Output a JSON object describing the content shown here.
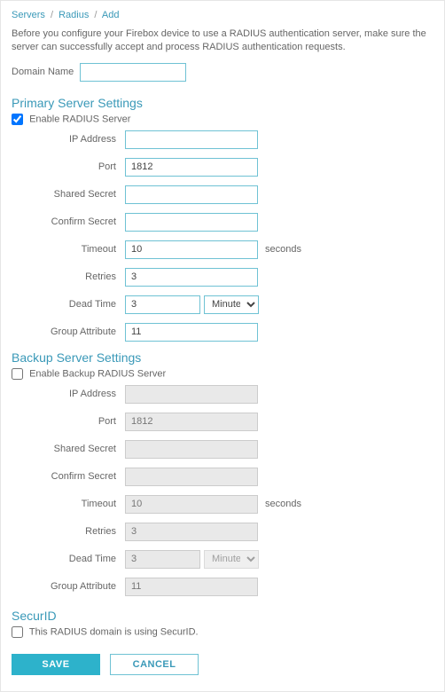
{
  "breadcrumb": {
    "servers": "Servers",
    "radius": "Radius",
    "add": "Add",
    "sep": "/"
  },
  "intro_text": "Before you configure your Firebox device to use a RADIUS authentication server, make sure the server can successfully accept and process RADIUS authentication requests.",
  "domain": {
    "label": "Domain Name",
    "value": ""
  },
  "primary": {
    "title": "Primary Server Settings",
    "enable_label": "Enable RADIUS Server",
    "enabled": true,
    "fields": {
      "ip_label": "IP Address",
      "ip_value": "",
      "port_label": "Port",
      "port_value": "1812",
      "shared_label": "Shared Secret",
      "shared_value": "",
      "confirm_label": "Confirm Secret",
      "confirm_value": "",
      "timeout_label": "Timeout",
      "timeout_value": "10",
      "timeout_unit": "seconds",
      "retries_label": "Retries",
      "retries_value": "3",
      "dead_label": "Dead Time",
      "dead_value": "3",
      "dead_unit": "Minutes",
      "group_label": "Group Attribute",
      "group_value": "11"
    }
  },
  "backup": {
    "title": "Backup Server Settings",
    "enable_label": "Enable Backup RADIUS Server",
    "enabled": false,
    "fields": {
      "ip_label": "IP Address",
      "ip_value": "",
      "port_label": "Port",
      "port_value": "1812",
      "shared_label": "Shared Secret",
      "shared_value": "",
      "confirm_label": "Confirm Secret",
      "confirm_value": "",
      "timeout_label": "Timeout",
      "timeout_value": "10",
      "timeout_unit": "seconds",
      "retries_label": "Retries",
      "retries_value": "3",
      "dead_label": "Dead Time",
      "dead_value": "3",
      "dead_unit": "Minutes",
      "group_label": "Group Attribute",
      "group_value": "11"
    }
  },
  "securid": {
    "title": "SecurID",
    "checkbox_label": "This RADIUS domain is using SecurID.",
    "checked": false
  },
  "buttons": {
    "save": "SAVE",
    "cancel": "CANCEL"
  }
}
